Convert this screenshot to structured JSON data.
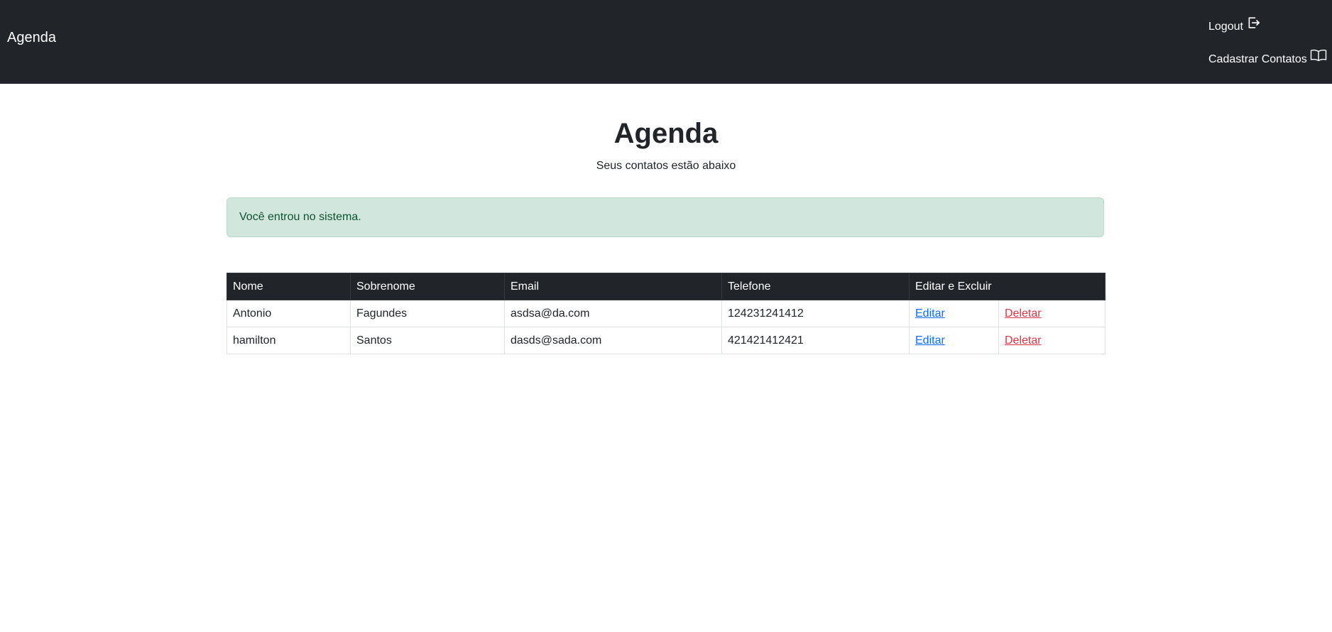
{
  "navbar": {
    "brand": "Agenda",
    "links": [
      {
        "label": "Logout",
        "icon": "logout-icon"
      },
      {
        "label": "Cadastrar Contatos",
        "icon": "book-icon"
      }
    ]
  },
  "header": {
    "title": "Agenda",
    "subtitle": "Seus contatos estão abaixo"
  },
  "alert": {
    "message": "Você entrou no sistema.",
    "color": "#d1e7dd"
  },
  "table": {
    "columns": [
      "Nome",
      "Sobrenome",
      "Email",
      "Telefone",
      "Editar e Excluir"
    ],
    "rows": [
      {
        "nome": "Antonio",
        "sobrenome": "Fagundes",
        "email": "asdsa@da.com",
        "telefone": "124231241412",
        "edit_label": "Editar",
        "delete_label": "Deletar"
      },
      {
        "nome": "hamilton",
        "sobrenome": "Santos",
        "email": "dasds@sada.com",
        "telefone": "421421412421",
        "edit_label": "Editar",
        "delete_label": "Deletar"
      }
    ]
  },
  "colors": {
    "navbar_bg": "#212529",
    "link": "#0d6efd",
    "danger": "#dc3545"
  }
}
